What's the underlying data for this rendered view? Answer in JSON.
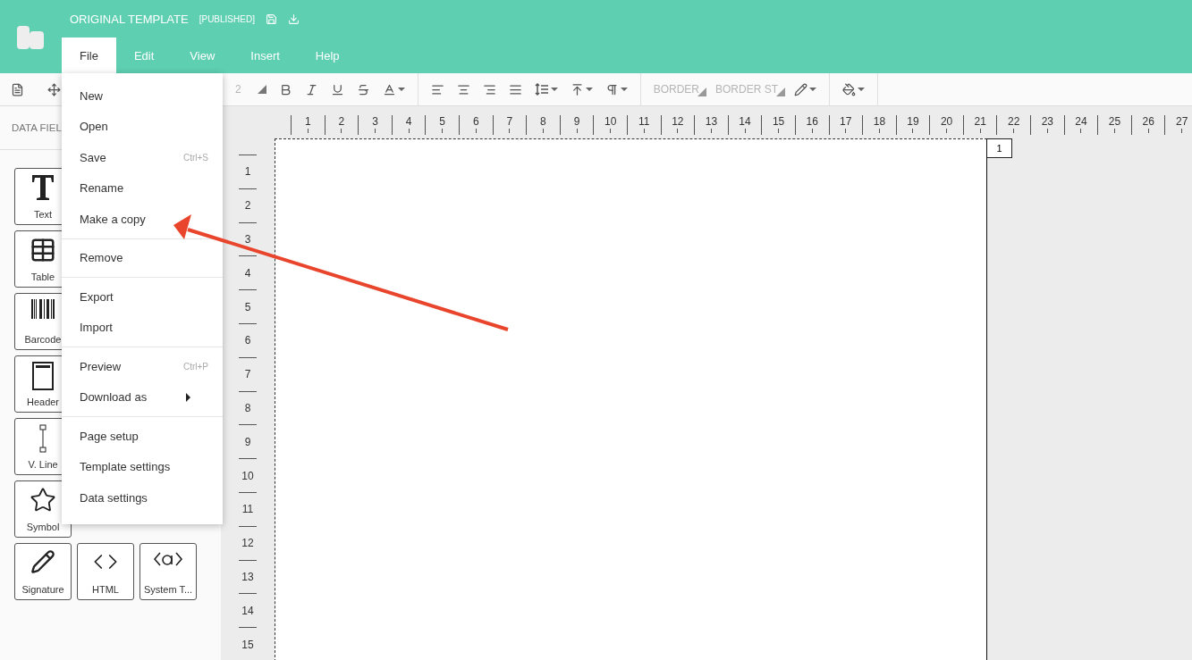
{
  "header": {
    "title": "ORIGINAL TEMPLATE",
    "status": "[PUBLISHED]"
  },
  "menubar": [
    {
      "label": "File",
      "selected": true
    },
    {
      "label": "Edit",
      "selected": false
    },
    {
      "label": "View",
      "selected": false
    },
    {
      "label": "Insert",
      "selected": false
    },
    {
      "label": "Help",
      "selected": false
    }
  ],
  "toolbar": {
    "lead": [
      {
        "kind": "page"
      },
      {
        "kind": "move"
      }
    ],
    "groups": [
      [
        {
          "kind": "text",
          "label": "2",
          "dropdown": false
        },
        {
          "kind": "corner"
        },
        {
          "kind": "bold"
        },
        {
          "kind": "italic"
        },
        {
          "kind": "underline"
        },
        {
          "kind": "strike"
        },
        {
          "kind": "fontcolor",
          "dropdown": true
        }
      ],
      [
        {
          "kind": "alignleft"
        },
        {
          "kind": "aligncenter"
        },
        {
          "kind": "alignright"
        },
        {
          "kind": "justify"
        },
        {
          "kind": "lineheight",
          "dropdown": true
        },
        {
          "kind": "valign",
          "dropdown": true
        },
        {
          "kind": "paragraph",
          "dropdown": true
        }
      ],
      [
        {
          "kind": "text",
          "label": "BORDER",
          "dropdown": true
        },
        {
          "kind": "text",
          "label": "BORDER ST",
          "dropdown": true
        },
        {
          "kind": "pen",
          "dropdown": true
        }
      ],
      [
        {
          "kind": "fill",
          "dropdown": true
        }
      ]
    ]
  },
  "sidebar": {
    "tab": "DATA FIEL",
    "rows": [
      [
        {
          "kind": "text",
          "label": "Text"
        }
      ],
      [
        {
          "kind": "table",
          "label": "Table"
        }
      ],
      [
        {
          "kind": "barcode",
          "label": "Barcode"
        }
      ],
      [
        {
          "kind": "header",
          "label": "Header"
        }
      ],
      [
        {
          "kind": "vline",
          "label": "V. Line"
        }
      ],
      [
        {
          "kind": "symbol",
          "label": "Symbol"
        }
      ],
      [
        {
          "kind": "signature",
          "label": "Signature"
        },
        {
          "kind": "html",
          "label": "HTML"
        },
        {
          "kind": "systemtext",
          "label": "System T..."
        }
      ]
    ]
  },
  "ruler": {
    "horizontal": [
      "1",
      "2",
      "3",
      "4",
      "5",
      "6",
      "7",
      "8",
      "9",
      "10",
      "11",
      "12",
      "13",
      "14",
      "15",
      "16",
      "17",
      "18",
      "19",
      "20",
      "21",
      "22",
      "23",
      "24",
      "25",
      "26",
      "27"
    ],
    "vertical": [
      "1",
      "2",
      "3",
      "4",
      "5",
      "6",
      "7",
      "8",
      "9",
      "10",
      "11",
      "12",
      "13",
      "14",
      "15"
    ]
  },
  "page": {
    "number": "1"
  },
  "file_menu": {
    "groups": [
      [
        {
          "label": "New"
        },
        {
          "label": "Open"
        },
        {
          "label": "Save",
          "shortcut": "Ctrl+S"
        },
        {
          "label": "Rename"
        },
        {
          "label": "Make a copy"
        }
      ],
      [
        {
          "label": "Remove"
        }
      ],
      [
        {
          "label": "Export"
        },
        {
          "label": "Import"
        }
      ],
      [
        {
          "label": "Preview",
          "shortcut": "Ctrl+P"
        },
        {
          "label": "Download as",
          "submenu": true
        }
      ],
      [
        {
          "label": "Page setup"
        },
        {
          "label": "Template settings"
        },
        {
          "label": "Data settings"
        }
      ]
    ]
  },
  "annotation": {
    "kind": "arrow"
  }
}
